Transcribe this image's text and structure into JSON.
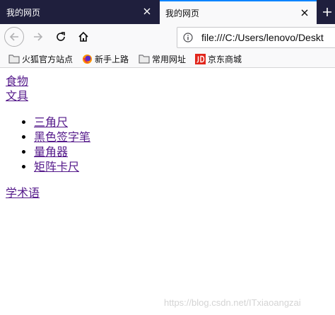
{
  "tabs": [
    {
      "title": "我的网页",
      "active": false
    },
    {
      "title": "我的网页",
      "active": true
    }
  ],
  "toolbar": {
    "back_icon": "arrow-left-icon",
    "forward_icon": "arrow-right-icon",
    "reload_icon": "reload-icon",
    "home_icon": "home-icon"
  },
  "urlbar": {
    "info_icon": "info-icon",
    "url": "file:///C:/Users/lenovo/Deskt"
  },
  "bookmarks": [
    {
      "label": "火狐官方站点",
      "icon": "folder-icon"
    },
    {
      "label": "新手上路",
      "icon": "firefox-icon"
    },
    {
      "label": "常用网址",
      "icon": "folder-icon"
    },
    {
      "label": "京东商城",
      "icon": "jd-icon"
    }
  ],
  "page": {
    "links_top": [
      "食物",
      "文具"
    ],
    "list_items": [
      "三角尺",
      "黑色签字笔",
      "量角器",
      "矩阵卡尺"
    ],
    "link_bottom": "学术语"
  },
  "watermark": "https://blog.csdn.net/ITxiaoangzai",
  "colors": {
    "tabstrip_bg": "#1f1f3d",
    "active_tab_accent": "#0a84ff",
    "visited_link": "#551a8b"
  }
}
